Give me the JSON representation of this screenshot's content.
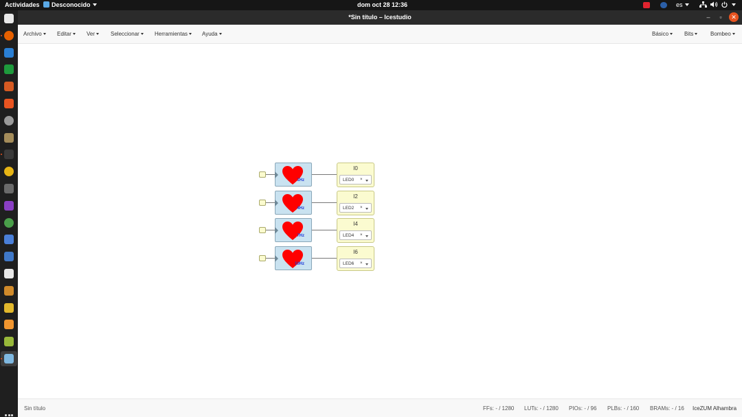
{
  "topbar": {
    "activities": "Actividades",
    "app_name": "Desconocido",
    "clock": "dom oct 28  12:36",
    "keyboard_layout": "es"
  },
  "dock": {
    "apps": [
      {
        "icon": "files-icon",
        "color": "#e8e8e8"
      },
      {
        "icon": "firefox-icon",
        "color": "#e66000"
      },
      {
        "icon": "writer-icon",
        "color": "#2a7fd4"
      },
      {
        "icon": "calc-icon",
        "color": "#1e9a3c"
      },
      {
        "icon": "impress-icon",
        "color": "#d65a22"
      },
      {
        "icon": "software-center-icon",
        "color": "#e95420"
      },
      {
        "icon": "settings-icon",
        "color": "#9a9a9a"
      },
      {
        "icon": "archive-icon",
        "color": "#a48c5a"
      },
      {
        "icon": "terminal-icon",
        "color": "#3a3a3a"
      },
      {
        "icon": "chrome-icon",
        "color": "#e7b515"
      },
      {
        "icon": "inkscape-icon",
        "color": "#6a6a6a"
      },
      {
        "icon": "media-icon",
        "color": "#8a3fc4"
      },
      {
        "icon": "globe-icon",
        "color": "#4a9f4a"
      },
      {
        "icon": "editor-icon",
        "color": "#4a7fd8"
      },
      {
        "icon": "viewer-icon",
        "color": "#3f78c8"
      },
      {
        "icon": "typography-icon",
        "color": "#e8e8e8"
      },
      {
        "icon": "notes-icon",
        "color": "#d08a2a"
      },
      {
        "icon": "document-icon",
        "color": "#e2b82c"
      },
      {
        "icon": "sublime-icon",
        "color": "#f1952f"
      },
      {
        "icon": "leaf-icon",
        "color": "#98b83a"
      },
      {
        "icon": "icestudio-icon",
        "color": "#7fb8e0"
      }
    ]
  },
  "window": {
    "title": "*Sin título – Icestudio",
    "minimize": "–",
    "maximize": "▫",
    "close": "✕"
  },
  "menubar": {
    "left": [
      "Archivo",
      "Editar",
      "Ver",
      "Seleccionar",
      "Herramientas",
      "Ayuda"
    ],
    "right": [
      "Básico",
      "Bits",
      "Bombeo"
    ]
  },
  "circuit": {
    "rows": [
      {
        "clock_freq": "1Hz",
        "output_name": "I0",
        "pin": "LED0"
      },
      {
        "clock_freq": "4Hz",
        "output_name": "I2",
        "pin": "LED2"
      },
      {
        "clock_freq": "7Hz",
        "output_name": "I4",
        "pin": "LED4"
      },
      {
        "clock_freq": "10Hz",
        "output_name": "I6",
        "pin": "LED6"
      }
    ],
    "clear_symbol": "×",
    "heart_color": "#ff0000"
  },
  "status": {
    "filename": "Sin título",
    "ffs": "FFs:  - / 1280",
    "luts": "LUTs:  - / 1280",
    "pios": "PIOs:  - / 96",
    "plbs": "PLBs:  - / 160",
    "brams": "BRAMs:  - / 16",
    "board": "IceZUM Alhambra"
  }
}
